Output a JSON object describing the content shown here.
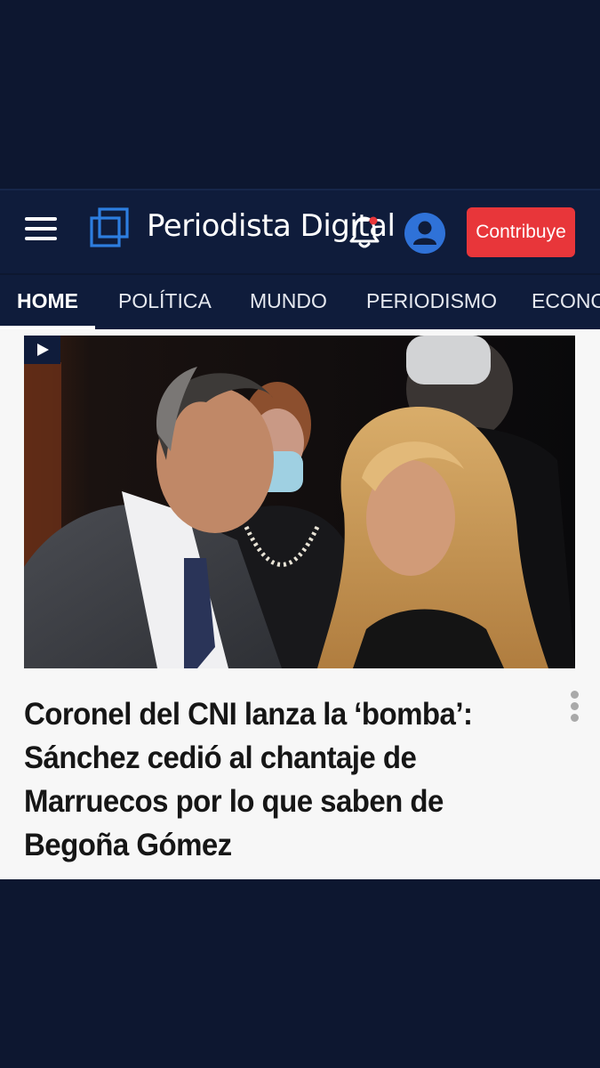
{
  "header": {
    "logo_text": "Periodista Digital",
    "contribute_label": "Contribuye",
    "icons": {
      "menu": "hamburger-menu-icon",
      "logo": "logo-mark-icon",
      "notifications": "bell-icon",
      "account": "user-icon"
    },
    "colors": {
      "background": "#0f1c3b",
      "contribute": "#e8363a",
      "account": "#2f72d8"
    }
  },
  "nav": {
    "tabs": [
      {
        "label": "HOME",
        "active": true
      },
      {
        "label": "POLÍTICA",
        "active": false
      },
      {
        "label": "MUNDO",
        "active": false
      },
      {
        "label": "PERIODISMO",
        "active": false
      },
      {
        "label": "ECONO",
        "active": false
      }
    ]
  },
  "article": {
    "headline": "Coronel del CNI lanza la ‘bomba’: Sánchez cedió al chantaje de Marruecos por lo que saben de Begoña Gómez",
    "media_badge_icon": "play-icon",
    "more_icon": "more-vertical-icon"
  }
}
